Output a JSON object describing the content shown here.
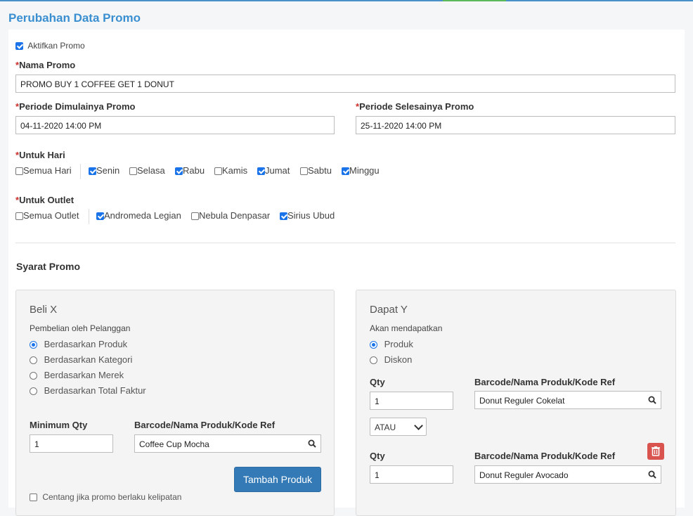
{
  "page_title": "Perubahan Data Promo",
  "activate": {
    "label": "Aktifkan Promo",
    "checked": true
  },
  "nama_promo": {
    "label": "Nama Promo",
    "value": "PROMO BUY 1 COFFEE GET 1 DONUT"
  },
  "periode_mulai": {
    "label": "Periode Dimulainya Promo",
    "value": "04-11-2020 14:00 PM"
  },
  "periode_selesai": {
    "label": "Periode Selesainya Promo",
    "value": "25-11-2020 14:00 PM"
  },
  "untuk_hari": {
    "label": "Untuk Hari",
    "all": {
      "label": "Semua Hari",
      "checked": false
    },
    "days": [
      {
        "label": "Senin",
        "checked": true
      },
      {
        "label": "Selasa",
        "checked": false
      },
      {
        "label": "Rabu",
        "checked": true
      },
      {
        "label": "Kamis",
        "checked": false
      },
      {
        "label": "Jumat",
        "checked": true
      },
      {
        "label": "Sabtu",
        "checked": false
      },
      {
        "label": "Minggu",
        "checked": true
      }
    ]
  },
  "untuk_outlet": {
    "label": "Untuk Outlet",
    "all": {
      "label": "Semua Outlet",
      "checked": false
    },
    "outlets": [
      {
        "label": "Andromeda Legian",
        "checked": true
      },
      {
        "label": "Nebula Denpasar",
        "checked": false
      },
      {
        "label": "Sirius Ubud",
        "checked": true
      }
    ]
  },
  "syarat": {
    "title": "Syarat Promo",
    "beli": {
      "title": "Beli X",
      "subtitle": "Pembelian oleh Pelanggan",
      "options": [
        {
          "label": "Berdasarkan Produk",
          "selected": true
        },
        {
          "label": "Berdasarkan Kategori",
          "selected": false
        },
        {
          "label": "Berdasarkan Merek",
          "selected": false
        },
        {
          "label": "Berdasarkan Total Faktur",
          "selected": false
        }
      ],
      "min_qty_label": "Minimum Qty",
      "min_qty_value": "1",
      "barcode_label": "Barcode/Nama Produk/Kode Ref",
      "barcode_value": "Coffee Cup Mocha",
      "add_button": "Tambah Produk",
      "footer_checkbox": "Centang jika promo berlaku kelipatan"
    },
    "dapat": {
      "title": "Dapat Y",
      "subtitle": "Akan mendapatkan",
      "options": [
        {
          "label": "Produk",
          "selected": true
        },
        {
          "label": "Diskon",
          "selected": false
        }
      ],
      "rows": [
        {
          "qty_label": "Qty",
          "qty_value": "1",
          "barcode_label": "Barcode/Nama Produk/Kode Ref",
          "barcode_value": "Donut Reguler Cokelat"
        },
        {
          "qty_label": "Qty",
          "qty_value": "1",
          "barcode_label": "Barcode/Nama Produk/Kode Ref",
          "barcode_value": "Donut Reguler Avocado"
        }
      ],
      "connector": "ATAU"
    }
  },
  "colors": {
    "accent": "#3a8fd1",
    "primary_button": "#337ab7",
    "danger": "#d9534f",
    "checkbox": "#1a73e8"
  }
}
